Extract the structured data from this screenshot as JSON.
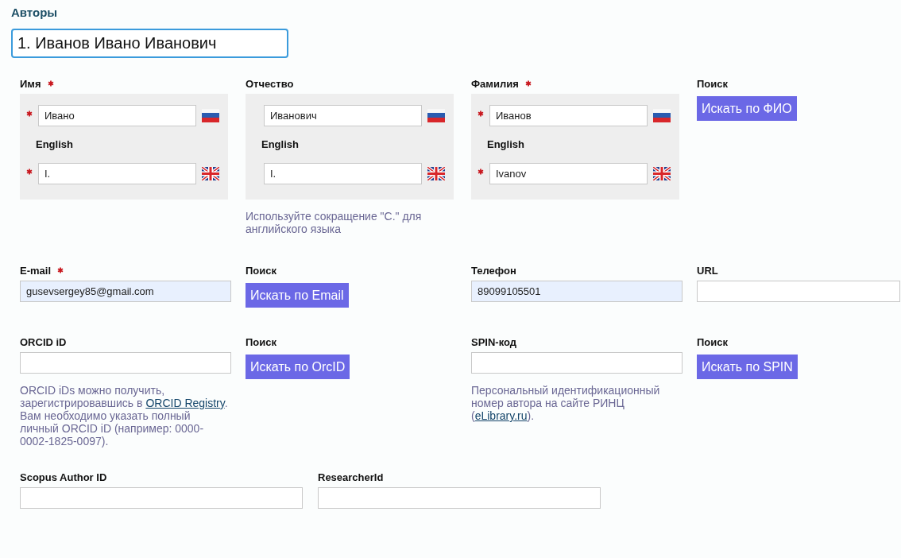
{
  "section_title": "Авторы",
  "author_selector": {
    "value": "1. Иванов Ивано Иванович"
  },
  "name_fields": [
    {
      "label": "Имя",
      "required": true,
      "native": {
        "value": "Ивано",
        "required": true
      },
      "english_label": "English",
      "english": {
        "value": "I.",
        "required": true
      }
    },
    {
      "label": "Отчество",
      "required": false,
      "native": {
        "value": "Иванович",
        "required": false
      },
      "english_label": "English",
      "english": {
        "value": "I.",
        "required": false
      },
      "hint": {
        "text": "Используйте сокращение \"С.\" для английского языка"
      }
    },
    {
      "label": "Фамилия",
      "required": true,
      "native": {
        "value": "Иванов",
        "required": true
      },
      "english_label": "English",
      "english": {
        "value": "Ivanov",
        "required": true
      }
    },
    {
      "kind": "search",
      "label": "Поиск",
      "button": "Искать по ФИО"
    }
  ],
  "contact_row": [
    {
      "kind": "field",
      "label": "E-mail",
      "required": true,
      "value": "gusevsergey85@gmail.com",
      "autofilled": true
    },
    {
      "kind": "search",
      "label": "Поиск",
      "button": "Искать по Email"
    },
    {
      "kind": "field",
      "label": "Телефон",
      "required": false,
      "value": "89099105501",
      "autofilled": true
    },
    {
      "kind": "field",
      "label": "URL",
      "required": false,
      "autofilled": false
    }
  ],
  "id_row": [
    {
      "kind": "field",
      "label": "ORCID iD",
      "required": false,
      "autofilled": false,
      "hint": {
        "text": "ORCID iDs можно получить, зарегистрировавшись в ",
        "link": "ORCID Registry",
        "after": ". Вам необходимо указать полный личный ORCID iD (например: 0000-0002-1825-0097)."
      }
    },
    {
      "kind": "search",
      "label": "Поиск",
      "button": "Искать по OrcID"
    },
    {
      "kind": "field",
      "label": "SPIN-код",
      "required": false,
      "autofilled": false,
      "hint": {
        "text": "Персональный идентификационный номер автора на сайте РИНЦ (",
        "link": "eLibrary.ru",
        "after": ")."
      }
    },
    {
      "kind": "search",
      "label": "Поиск",
      "button": "Искать по SPIN"
    }
  ],
  "external_ids": [
    {
      "label": "Scopus Author ID"
    },
    {
      "label": "ResearcherId"
    }
  ]
}
